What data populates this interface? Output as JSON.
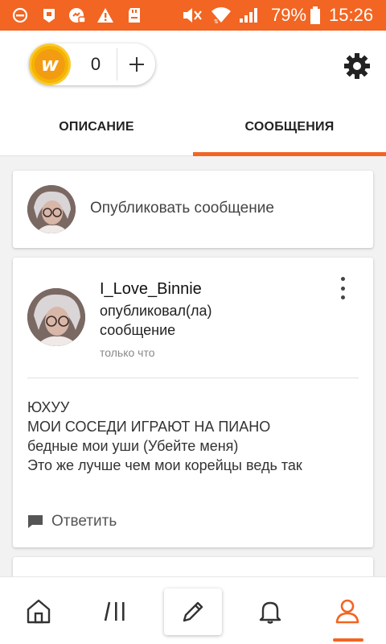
{
  "status_bar": {
    "battery_text": "79%",
    "time": "15:26",
    "icons": [
      "dnd-icon",
      "app-notification-icon",
      "messenger-notification-icon",
      "warning-icon",
      "sd-card-icon",
      "mute-icon",
      "wifi-icon",
      "signal-icon",
      "battery-icon"
    ],
    "color": "#f26522"
  },
  "header": {
    "coins_count": "0",
    "coin_icon": "coin-w-icon",
    "add_icon": "plus-icon",
    "settings_icon": "gear-icon"
  },
  "tabs": [
    {
      "label": "ОПИСАНИЕ",
      "active": false
    },
    {
      "label": "СООБЩЕНИЯ",
      "active": true
    }
  ],
  "compose": {
    "placeholder": "Опубликовать сообщение"
  },
  "post": {
    "author": "I_Love_Binnie",
    "action_line1": "опубликовал(ла)",
    "action_line2": "сообщение",
    "time": "только что",
    "body": [
      "ЮХУУ",
      "МОИ СОСЕДИ ИГРАЮТ НА ПИАНО",
      "бедные мои уши (Убейте меня)",
      "Это же лучше чем мои корейцы ведь так"
    ],
    "reply_label": "Ответить"
  },
  "bottom_nav": {
    "items": [
      "home-icon",
      "browse-icon",
      "create-pencil-icon",
      "notifications-bell-icon",
      "profile-icon"
    ],
    "active": "profile-icon"
  },
  "colors": {
    "accent": "#f26522",
    "coin": "#f4b400"
  }
}
